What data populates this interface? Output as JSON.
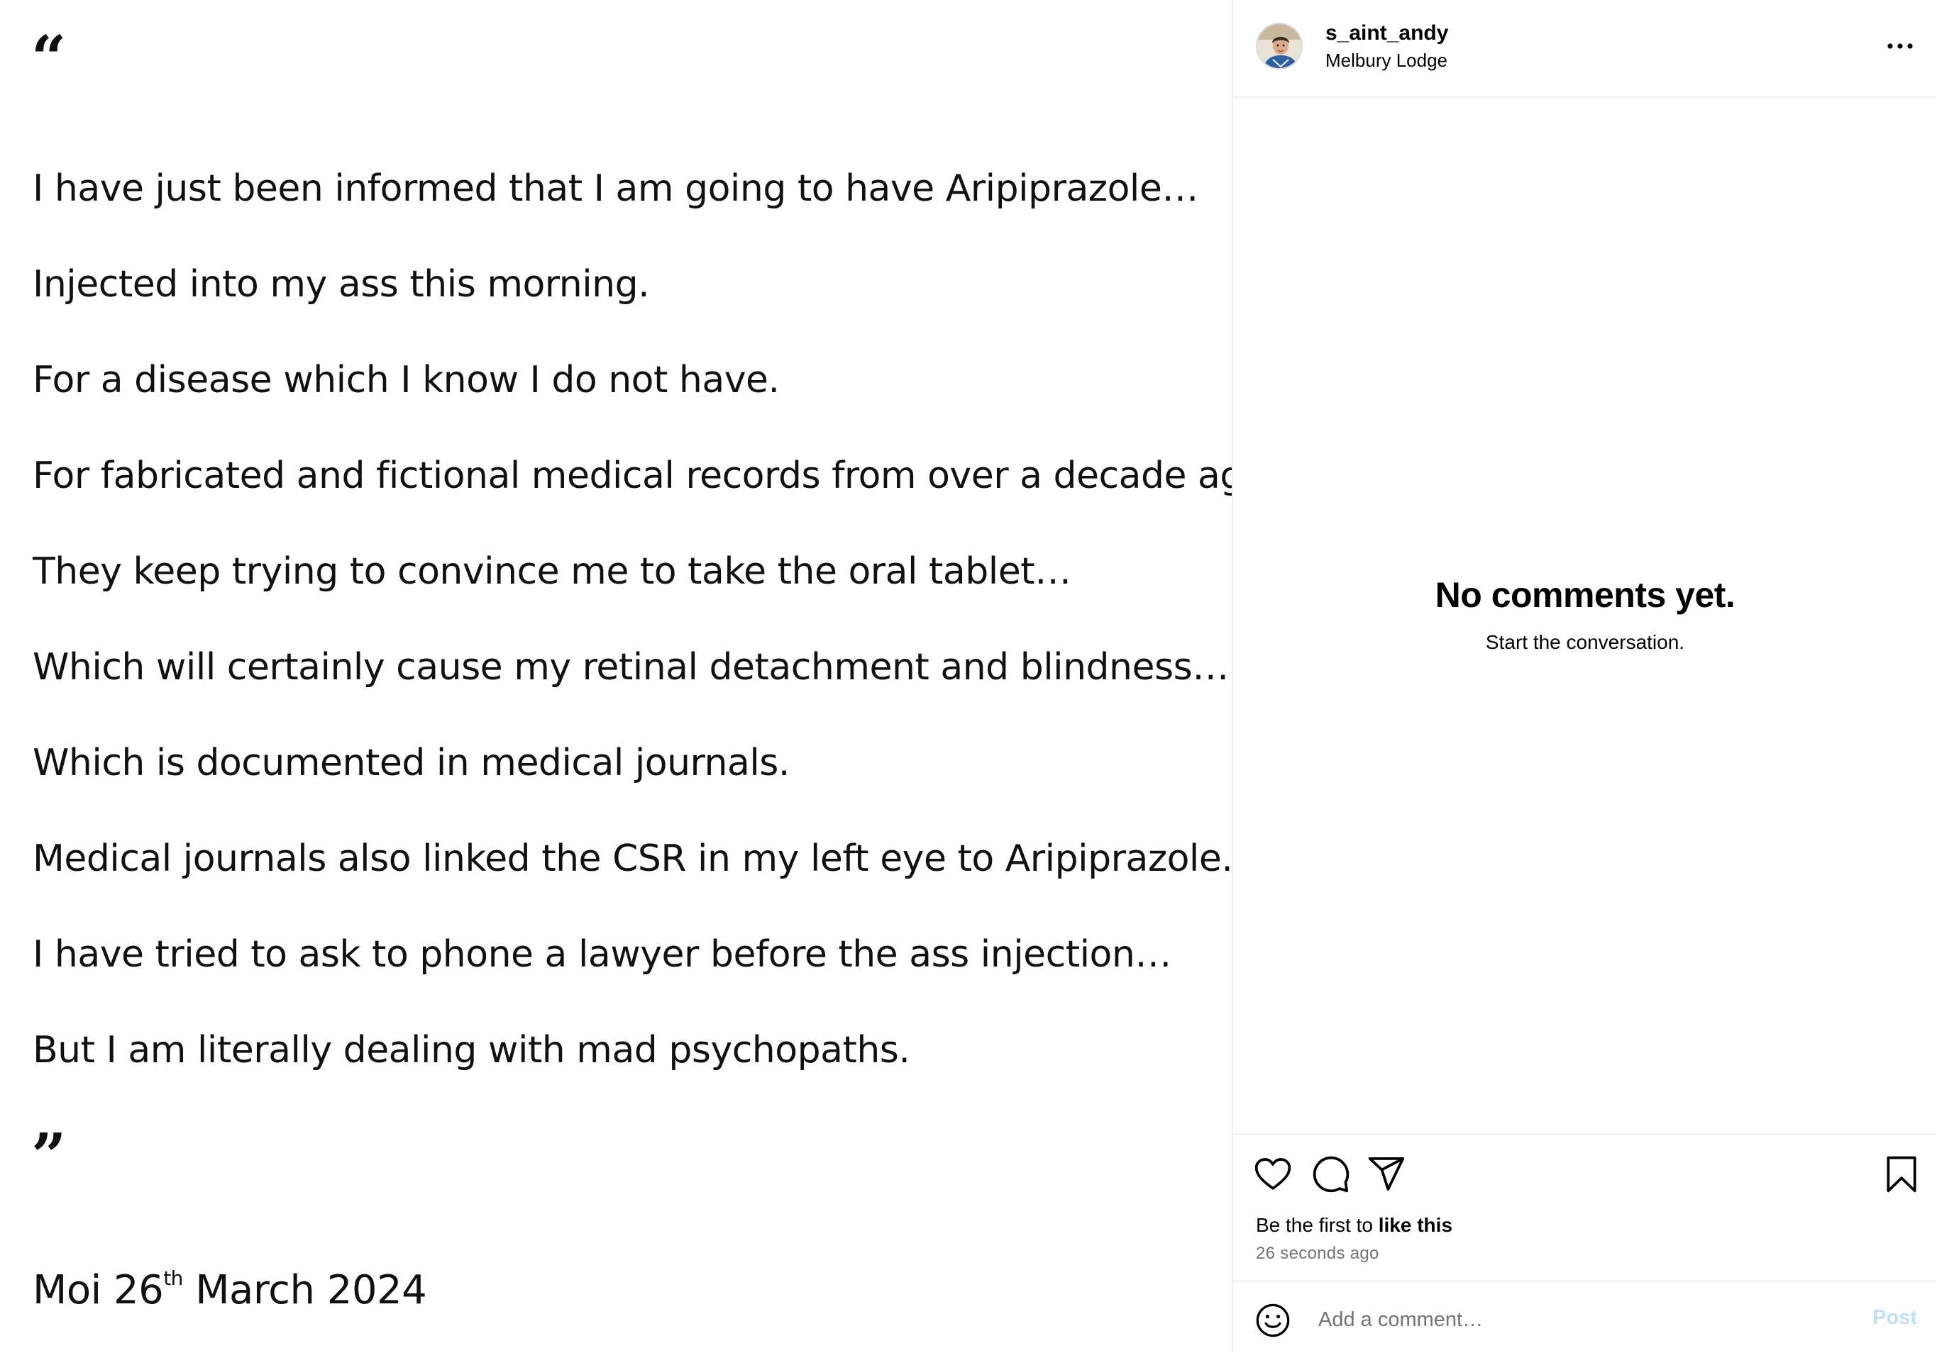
{
  "post": {
    "quote_open": "“",
    "quote_close": "”",
    "lines": [
      "I have just been informed that I am going to have Aripiprazole…",
      "Injected into my ass this morning.",
      "For a disease which I know I do not have.",
      "For fabricated and fictional medical records from over a decade ago.",
      "They keep trying to convince me to take the oral tablet…",
      "Which will certainly cause my retinal detachment and blindness…",
      "Which is documented in medical journals.",
      "Medical journals also linked the CSR in my left eye to Aripiprazole.",
      "I have tried to ask to phone a lawyer before the ass injection…",
      "But I am literally dealing with mad psychopaths."
    ],
    "date_prefix": "Moi 26",
    "date_suffix": "th",
    "date_rest": " March 2024"
  },
  "header": {
    "username": "s_aint_andy",
    "location": "Melbury Lodge",
    "more_icon": "more-horizontal-icon"
  },
  "comments": {
    "empty_title": "No comments yet.",
    "empty_subtitle": "Start the conversation."
  },
  "actions": {
    "icons": [
      "heart-icon",
      "comment-icon",
      "share-icon",
      "bookmark-icon"
    ],
    "likes_prefix": "Be the first to ",
    "likes_strong": "like this",
    "timestamp": "26 seconds ago"
  },
  "comment_bar": {
    "placeholder": "Add a comment…",
    "post_label": "Post",
    "emoji_icon": "emoji-icon"
  },
  "colors": {
    "muted_text": "#737373",
    "post_button_disabled": "#c0dffd",
    "divider": "#efefef"
  }
}
